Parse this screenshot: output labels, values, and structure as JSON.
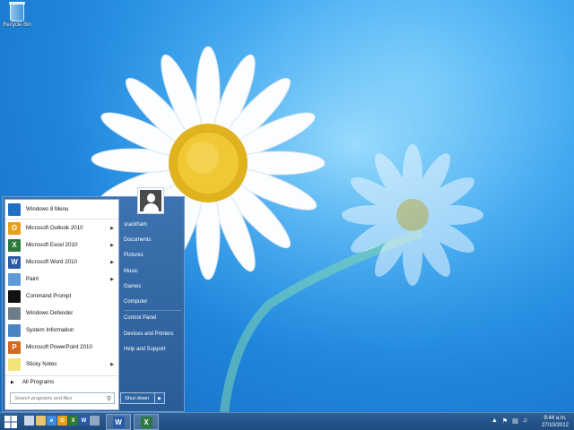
{
  "desktop": {
    "recycle_bin_label": "Recycle Bin"
  },
  "start_menu": {
    "programs": [
      {
        "label": "Windows 8 Menu",
        "icon": "windows8-menu-icon",
        "color": "#1f6fc5",
        "glyph": "",
        "submenu": false
      },
      {
        "label": "Microsoft Outlook 2010",
        "icon": "outlook-icon",
        "color": "#e8a01c",
        "glyph": "O",
        "submenu": true
      },
      {
        "label": "Microsoft Excel 2010",
        "icon": "excel-icon",
        "color": "#2b7a3c",
        "glyph": "X",
        "submenu": true
      },
      {
        "label": "Microsoft Word 2010",
        "icon": "word-icon",
        "color": "#2b5aa8",
        "glyph": "W",
        "submenu": true
      },
      {
        "label": "Paint",
        "icon": "paint-icon",
        "color": "#5d9ad6",
        "glyph": "",
        "submenu": true
      },
      {
        "label": "Command Prompt",
        "icon": "command-prompt-icon",
        "color": "#111111",
        "glyph": "",
        "submenu": false
      },
      {
        "label": "Windows Defender",
        "icon": "windows-defender-icon",
        "color": "#6e7c88",
        "glyph": "",
        "submenu": false
      },
      {
        "label": "System Information",
        "icon": "system-information-icon",
        "color": "#4a83c2",
        "glyph": "",
        "submenu": false
      },
      {
        "label": "Microsoft PowerPoint 2010",
        "icon": "powerpoint-icon",
        "color": "#d2691e",
        "glyph": "P",
        "submenu": false
      },
      {
        "label": "Sticky Notes",
        "icon": "sticky-notes-icon",
        "color": "#f2e27a",
        "glyph": "",
        "submenu": true
      }
    ],
    "all_programs_label": "All Programs",
    "search_placeholder": "Search programs and files",
    "right_items": [
      "srackham",
      "Documents",
      "Pictures",
      "Music",
      "Games",
      "Computer",
      "Control Panel",
      "Devices and Printers",
      "Help and Support"
    ],
    "shutdown_label": "Shut down"
  },
  "taskbar": {
    "time": "9:44 a.m.",
    "date": "27/10/2012"
  }
}
